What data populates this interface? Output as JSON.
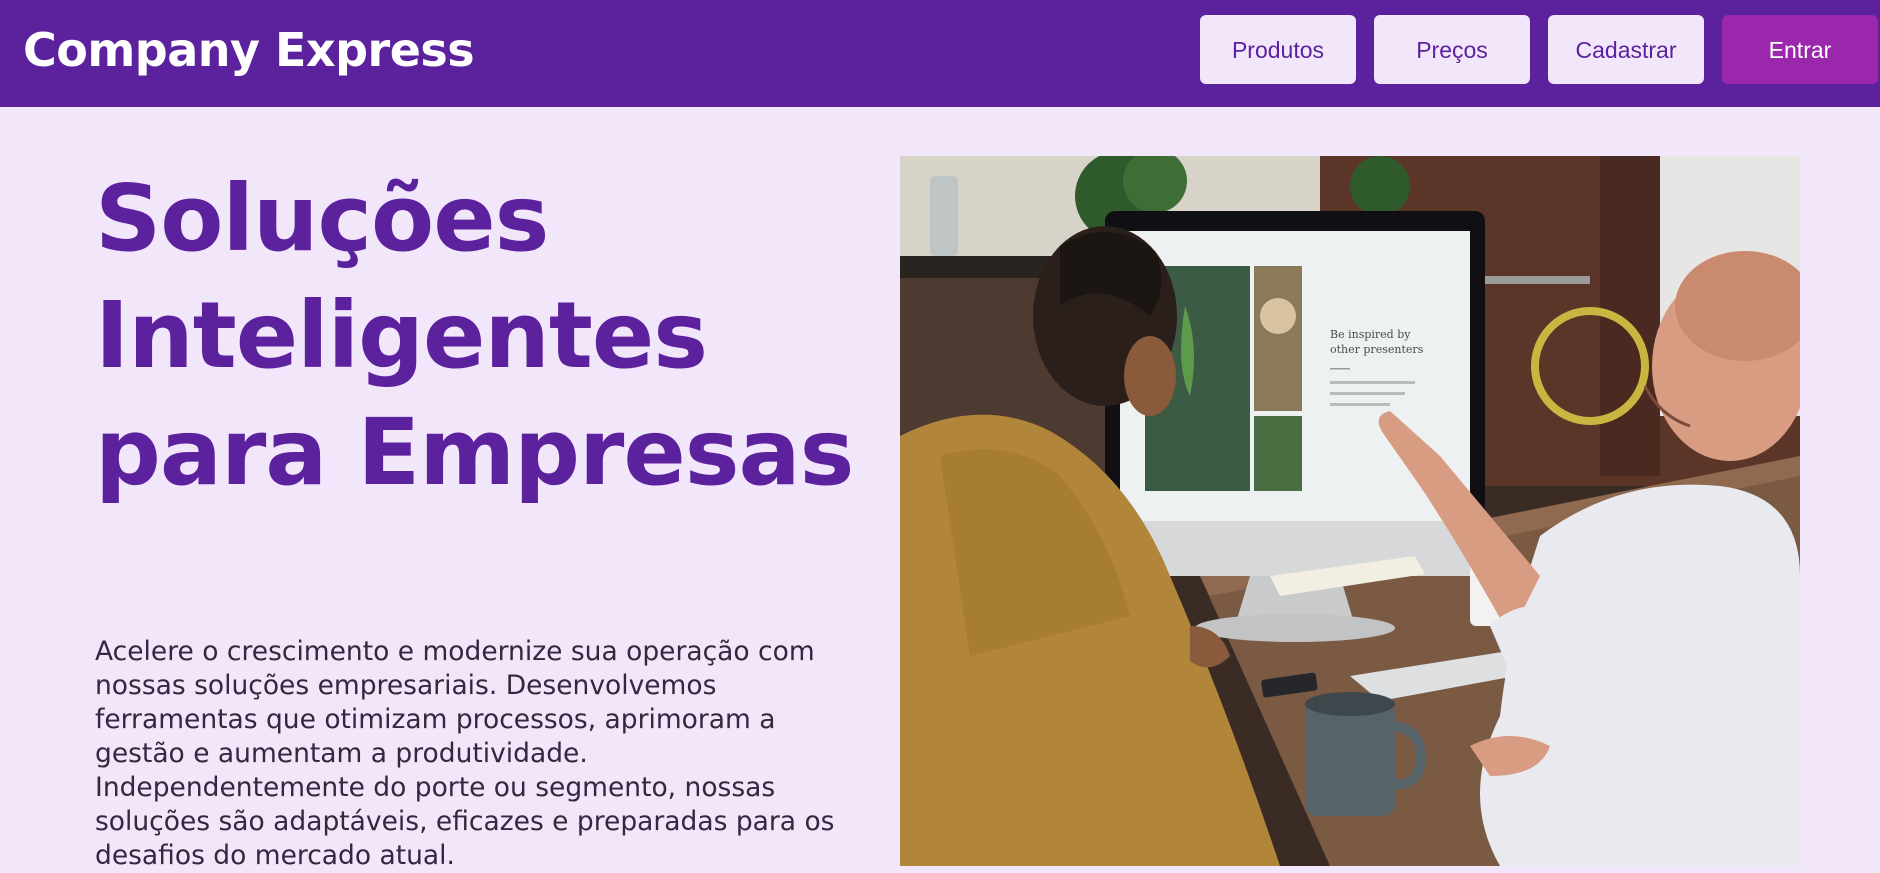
{
  "header": {
    "brand": "Company Express",
    "nav": {
      "products": "Produtos",
      "pricing": "Preços",
      "signup": "Cadastrar",
      "login": "Entrar"
    }
  },
  "hero": {
    "title": "Soluções Inteligentes para Empresas",
    "description": "Acelere o crescimento e modernize sua operação com nossas soluções empresariais. Desenvolvemos ferramentas que otimizam processos, aprimoram a gestão e aumentam a produtividade. Independentemente do porte ou segmento, nossas soluções são adaptáveis, eficazes e preparadas para os desafios do mercado atual.",
    "image": {
      "screen_heading_line1": "Be inspired by",
      "screen_heading_line2": "other presenters"
    }
  },
  "colors": {
    "header_bg": "#5c229d",
    "page_bg": "#f2e6fb",
    "accent_button": "#9b27ad",
    "title": "#5c229d"
  }
}
